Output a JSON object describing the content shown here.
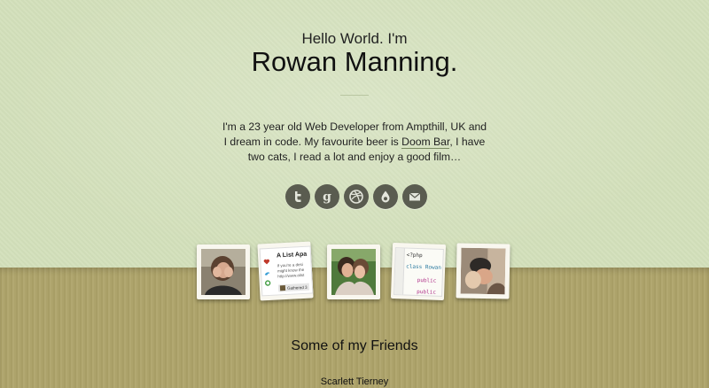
{
  "hero": {
    "greeting": "Hello World. I'm",
    "name": "Rowan Manning."
  },
  "bio": {
    "text_before": "I'm a 23 year old Web Developer from Ampthill, UK and I dream in code. My favourite beer is ",
    "beer_link": "Doom Bar",
    "text_after": ", I have two cats, I read a lot and enjoy a good film…"
  },
  "social": [
    {
      "icon": "twitter-icon"
    },
    {
      "icon": "google-icon"
    },
    {
      "icon": "dribbble-icon"
    },
    {
      "icon": "water-drop-icon"
    },
    {
      "icon": "email-icon"
    }
  ],
  "projects": {
    "alistapart": {
      "title": "A List Apa",
      "body": [
        "If you're a desi",
        "might know the",
        "http://www.alist"
      ],
      "footer": "Gathered 3"
    },
    "code": {
      "tag": "<?php",
      "line1": "class Rowan",
      "line2": "public",
      "line3": "public"
    }
  },
  "friends": {
    "title": "Some of my Friends",
    "first_name": "Scarlett Tierney"
  },
  "colors": {
    "top_background": "#d3e0bb",
    "bottom_background": "#ada36b",
    "icon_fill": "#5a5c50"
  }
}
